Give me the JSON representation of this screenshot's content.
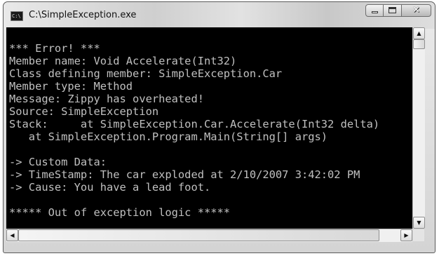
{
  "window": {
    "title": "C:\\SimpleException.exe",
    "icon_label": "C:\\",
    "controls": {
      "minimize": "minimize-icon",
      "maximize": "maximize-icon",
      "close": "✕"
    }
  },
  "console": {
    "background": "#000000",
    "text_color": "#c0c0c0",
    "lines": [
      "*** Error! ***",
      "Member name: Void Accelerate(Int32)",
      "Class defining member: SimpleException.Car",
      "Member type: Method",
      "Message: Zippy has overheated!",
      "Source: SimpleException",
      "Stack:     at SimpleException.Car.Accelerate(Int32 delta)",
      "   at SimpleException.Program.Main(String[] args)",
      "",
      "-> Custom Data:",
      "-> TimeStamp: The car exploded at 2/10/2007 3:42:02 PM",
      "-> Cause: You have a lead foot.",
      "",
      "***** Out of exception logic *****"
    ]
  },
  "scrollbars": {
    "up_arrow": "▲",
    "down_arrow": "▼",
    "left_arrow": "◀",
    "right_arrow": "▶"
  }
}
